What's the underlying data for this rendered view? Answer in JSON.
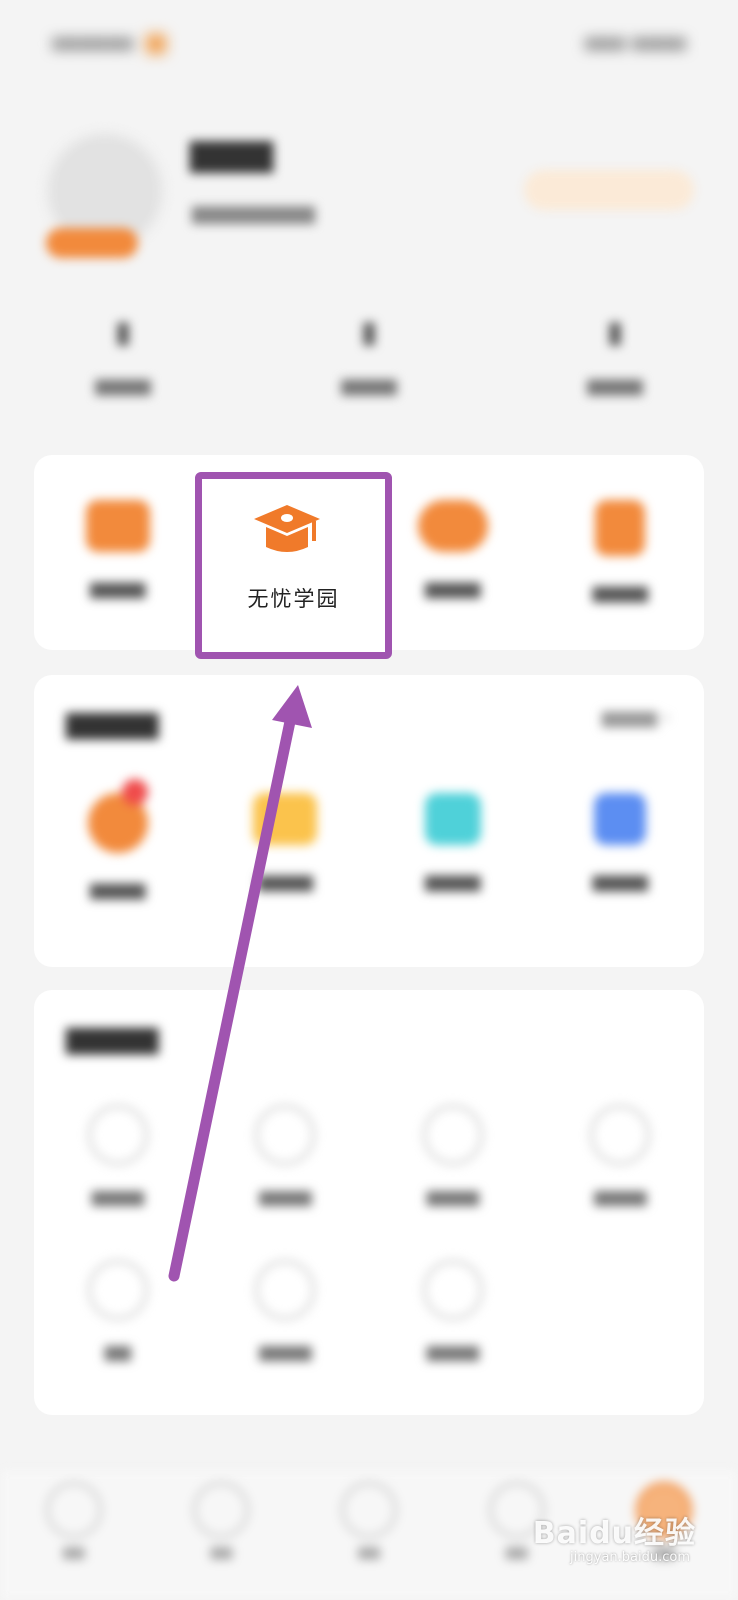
{
  "highlighted_item": {
    "label": "无忧学园",
    "icon": "graduation-cap-icon"
  },
  "colors": {
    "accent": "#f28a3c",
    "highlight_border": "#a054b0",
    "arrow": "#a054b0",
    "background": "#f4f4f4"
  },
  "watermark": {
    "text": "Baidu经验",
    "url": "jingyan.baidu.com"
  }
}
